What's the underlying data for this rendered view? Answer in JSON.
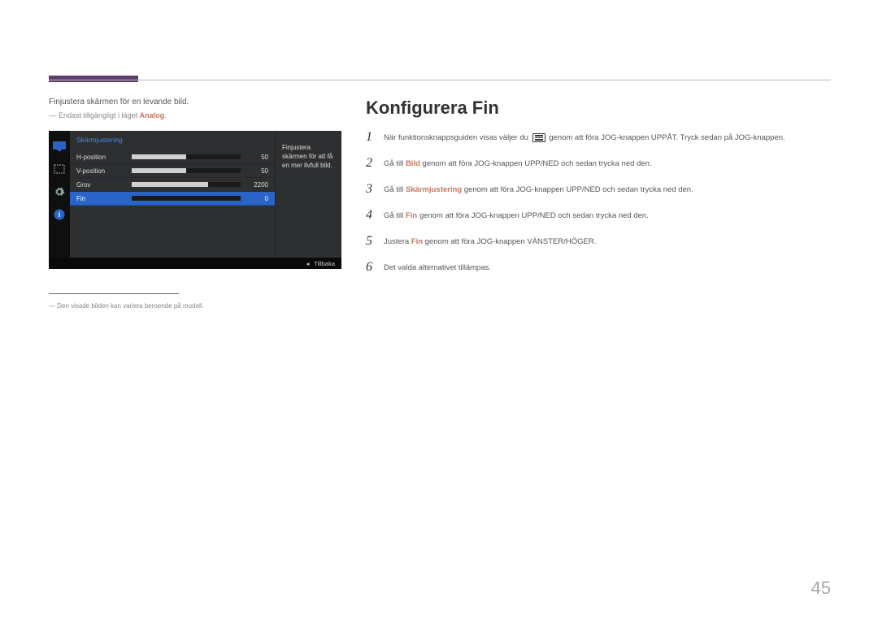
{
  "page_number": "45",
  "left": {
    "intro": "Finjustera skärmen för en levande bild.",
    "availability_prefix": "Endast tillgängligt i läget ",
    "availability_mode": "Analog",
    "footnote": "Den visade bilden kan variera beroende på modell."
  },
  "osd": {
    "title": "Skärmjustering",
    "items": [
      {
        "label": "H-position",
        "value": "50",
        "fillpct": 50,
        "selected": false
      },
      {
        "label": "V-position",
        "value": "50",
        "fillpct": 50,
        "selected": false
      },
      {
        "label": "Grov",
        "value": "2200",
        "fillpct": 70,
        "selected": false
      },
      {
        "label": "Fin",
        "value": "0",
        "fillpct": 0,
        "selected": true
      }
    ],
    "description": "Finjustera skärmen för att få en mer livfull bild.",
    "footer_back": "Tillbaka"
  },
  "heading": "Konfigurera Fin",
  "steps": [
    {
      "num": "1",
      "pre": "När funktionsknappsguiden visas väljer du ",
      "glyph": true,
      "post": " genom att föra JOG-knappen UPPÅT. Tryck sedan på JOG-knappen."
    },
    {
      "num": "2",
      "pre": "Gå till ",
      "bold": "Bild",
      "post": " genom att föra JOG-knappen UPP/NED och sedan trycka ned den."
    },
    {
      "num": "3",
      "pre": "Gå till ",
      "bold": "Skärmjustering",
      "post": " genom att föra JOG-knappen UPP/NED och sedan trycka ned den."
    },
    {
      "num": "4",
      "pre": "Gå till ",
      "bold": "Fin",
      "post": " genom att föra JOG-knappen UPP/NED och sedan trycka ned den."
    },
    {
      "num": "5",
      "pre": "Justera ",
      "bold": "Fin",
      "post": " genom att föra JOG-knappen VÄNSTER/HÖGER."
    },
    {
      "num": "6",
      "pre": "Det valda alternativet tillämpas."
    }
  ]
}
